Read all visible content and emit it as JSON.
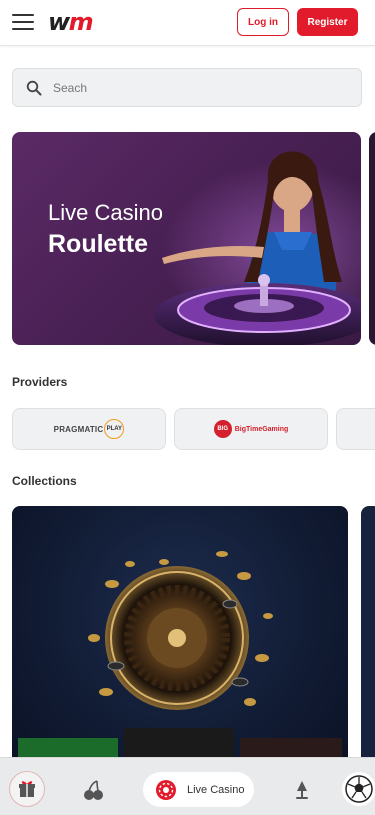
{
  "header": {
    "logo_w": "w",
    "logo_m": "m",
    "login_label": "Log in",
    "register_label": "Register"
  },
  "search": {
    "placeholder": "Seach"
  },
  "hero": {
    "line1": "Live Casino",
    "line2": "Roulette"
  },
  "providers": {
    "title": "Providers",
    "items": [
      {
        "name": "PRAGMATIC",
        "badge": "PLAY"
      },
      {
        "name": "BigTimeGaming",
        "badge": "BIG"
      }
    ]
  },
  "collections": {
    "title": "Collections"
  },
  "bottom_nav": {
    "items": [
      {
        "icon": "gift-icon"
      },
      {
        "icon": "cherry-icon"
      },
      {
        "icon": "live-casino-icon",
        "label": "Live Casino",
        "active": true
      },
      {
        "icon": "lamp-icon"
      },
      {
        "icon": "soccer-ball-icon"
      }
    ]
  },
  "colors": {
    "brand_red": "#e11b2b",
    "hero_purple": "#4a2155",
    "collection_navy": "#111b33"
  }
}
